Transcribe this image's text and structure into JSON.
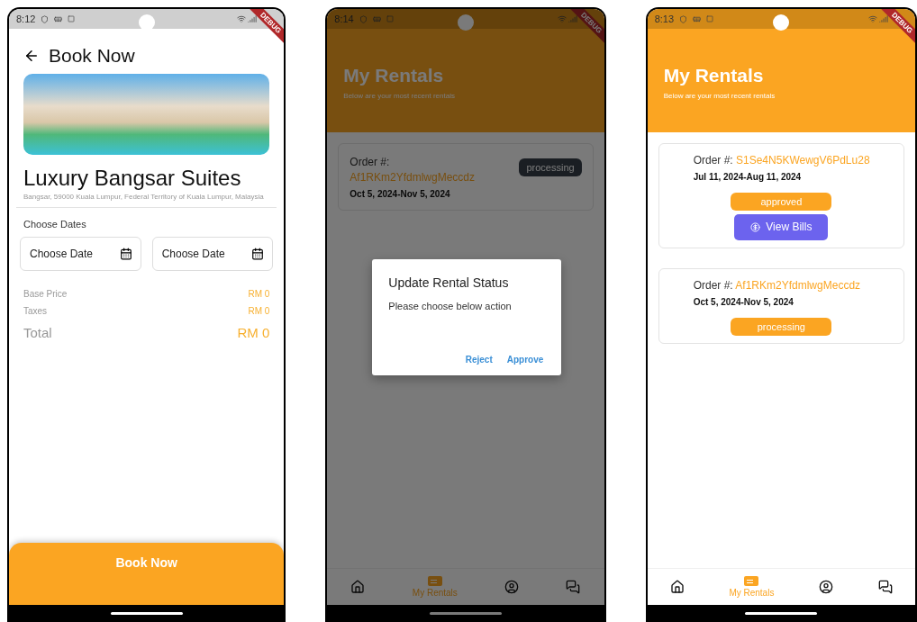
{
  "phones": [
    {
      "kind": "booking",
      "status_time": "8:12",
      "debug_banner": "DEBUG",
      "header": {
        "title": "Book Now"
      },
      "property": {
        "name": "Luxury Bangsar Suites",
        "address": "Bangsar, 59000 Kuala Lumpur, Federal Territory of Kuala Lumpur, Malaysia"
      },
      "dates_label": "Choose Dates",
      "date_fields": [
        {
          "placeholder": "Choose Date"
        },
        {
          "placeholder": "Choose Date"
        }
      ],
      "prices": [
        {
          "kind": "line",
          "label": "Base Price",
          "amount": "RM 0"
        },
        {
          "kind": "line",
          "label": "Taxes",
          "amount": "RM 0"
        },
        {
          "kind": "total",
          "label": "Total",
          "amount": "RM 0"
        }
      ],
      "action_button": "Book Now"
    },
    {
      "kind": "rentals",
      "status_time": "8:14",
      "debug_banner": "DEBUG",
      "dimmed": true,
      "header": {
        "title": "My Rentals",
        "subtitle": "Below are your most recent rentals"
      },
      "rentals": [
        {
          "kind": "inline",
          "order_label": "Order #:",
          "order_id": "Af1RKm2YfdmlwgMeccdz",
          "dates": "Oct 5, 2024-Nov 5, 2024",
          "badge": {
            "text": "processing",
            "kind": "dark"
          }
        }
      ],
      "dialog": {
        "title": "Update Rental Status",
        "message": "Please choose below action",
        "actions": [
          {
            "label": "Reject"
          },
          {
            "label": "Approve"
          }
        ]
      },
      "nav": [
        {
          "kind": "home",
          "selected": false
        },
        {
          "kind": "rentals",
          "label": "My Rentals",
          "selected": true
        },
        {
          "kind": "profile",
          "selected": false
        },
        {
          "kind": "chat",
          "selected": false
        }
      ]
    },
    {
      "kind": "rentals",
      "status_time": "8:13",
      "debug_banner": "DEBUG",
      "header": {
        "title": "My Rentals",
        "subtitle": "Below are your most recent rentals"
      },
      "rentals": [
        {
          "kind": "stacked",
          "order_label": "Order #:",
          "order_id": "S1Se4N5KWewgV6PdLu28",
          "dates": "Jul 11, 2024-Aug 11, 2024",
          "badge": {
            "text": "approved",
            "kind": "filled"
          },
          "action": {
            "label": "View Bills"
          }
        },
        {
          "kind": "stacked",
          "order_label": "Order #:",
          "order_id": "Af1RKm2YfdmlwgMeccdz",
          "dates": "Oct 5, 2024-Nov 5, 2024",
          "badge": {
            "text": "processing",
            "kind": "filled"
          }
        }
      ],
      "nav": [
        {
          "kind": "home",
          "selected": false
        },
        {
          "kind": "rentals",
          "label": "My Rentals",
          "selected": true
        },
        {
          "kind": "profile",
          "selected": false
        },
        {
          "kind": "chat",
          "selected": false
        }
      ]
    }
  ]
}
